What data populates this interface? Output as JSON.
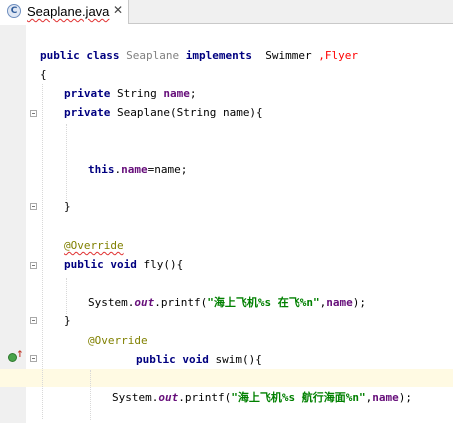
{
  "tab": {
    "icon_letter": "C",
    "filename": "Seaplane.java",
    "close": "✕"
  },
  "colors": {
    "keyword": "#000080",
    "field": "#660e7a",
    "string": "#008000",
    "annotation": "#808000",
    "error": "#ff0000"
  },
  "code": {
    "l1": {
      "kw1": "public",
      "kw2": "class",
      "classname": "Seaplane",
      "kw3": "implements",
      "iface1": "Swimmer",
      "iface2": ",Flyer"
    },
    "l2": {
      "text": "{"
    },
    "l3": {
      "kw": "private",
      "type": "String",
      "field": "name",
      "semi": ";"
    },
    "l4": {
      "kw": "private",
      "rest": "Seaplane(String name){"
    },
    "l5": {
      "this": "this",
      "dot": ".",
      "field": "name",
      "rest": "=name;"
    },
    "l6": {
      "text": "}"
    },
    "l7": {
      "annotation": "@Override"
    },
    "l8": {
      "kw1": "public",
      "kw2": "void",
      "method": "fly(){"
    },
    "l9": {
      "pre": "System.",
      "static": "out",
      "call": ".printf(",
      "str": "\"海上飞机%s 在飞%n\"",
      "comma": ",",
      "field": "name",
      "end": ");"
    },
    "l10": {
      "text": "}"
    },
    "l11": {
      "annotation": "@Override"
    },
    "l12": {
      "kw1": "public",
      "kw2": "void",
      "method": "swim(){"
    },
    "l13": {
      "pre": "System.",
      "static": "out",
      "call": ".printf(",
      "str": "\"海上飞机%s 航行海面%n\"",
      "comma": ",",
      "field": "name",
      "end": ");"
    }
  }
}
